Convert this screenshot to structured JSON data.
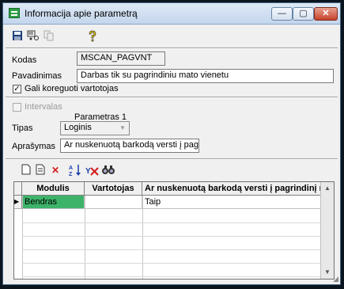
{
  "window": {
    "title": "Informacija apie parametrą",
    "minimize_label": "—",
    "maximize_label": "▢",
    "close_label": "✕"
  },
  "toolbar": {
    "icons": [
      "save-icon",
      "properties-icon",
      "copy-icon",
      "help-icon"
    ]
  },
  "form": {
    "kodas_label": "Kodas",
    "kodas_value": "MSCAN_PAGVNT",
    "pavadinimas_label": "Pavadinimas",
    "pavadinimas_value": "Darbas tik su pagrindiniu mato vienetu",
    "editable_label": "Gali koreguoti vartotojas",
    "editable_checked": true,
    "intervalas_label": "Intervalas",
    "intervalas_checked": false,
    "param_header": "Parametras 1",
    "tipas_label": "Tipas",
    "tipas_value": "Loginis",
    "aprasymas_label": "Aprašymas",
    "aprasymas_value": "Ar nuskenuotą barkodą versti į pag"
  },
  "grid_toolbar": {
    "icons": [
      "new-icon",
      "edit-icon",
      "delete-icon",
      "sort-icon",
      "filter-clear-icon",
      "find-icon"
    ]
  },
  "grid": {
    "columns": [
      "Modulis",
      "Vartotojas",
      "Ar nuskenuotą barkodą versti į pagrindinį mato"
    ],
    "rows": [
      {
        "indicator": "▶",
        "modulis": "Bendras",
        "vartotojas": "",
        "value": "Taip"
      }
    ]
  }
}
